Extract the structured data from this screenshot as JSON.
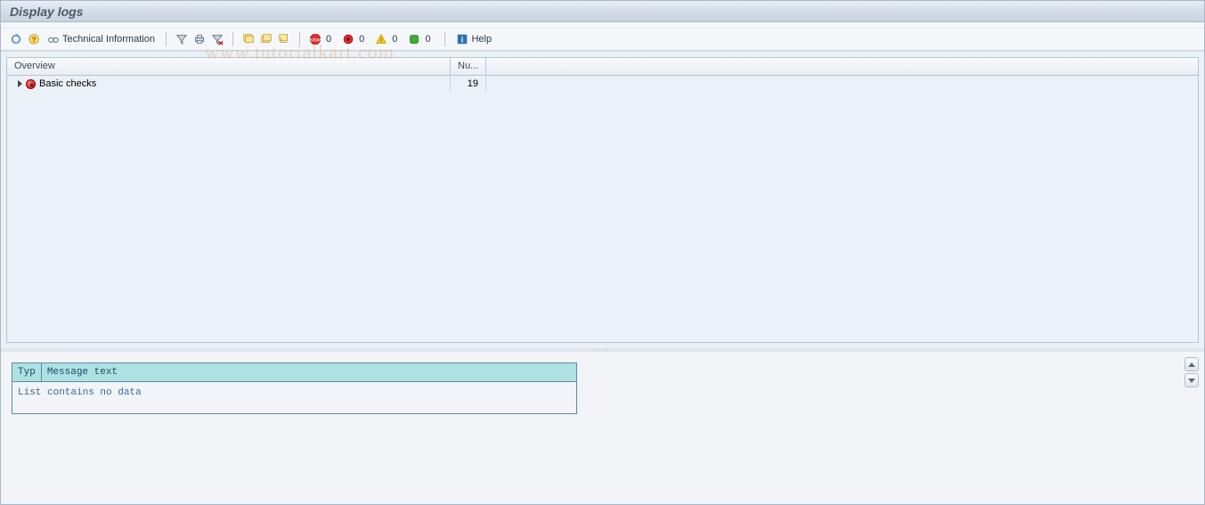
{
  "title": "Display logs",
  "toolbar": {
    "tech_info_label": "Technical Information",
    "cancel_count": "0",
    "error_count": "0",
    "warning_count": "0",
    "success_count": "0",
    "help_label": "Help"
  },
  "grid": {
    "headers": {
      "overview": "Overview",
      "num": "Nu..."
    },
    "rows": [
      {
        "label": "Basic checks",
        "count": "19",
        "status": "error"
      }
    ]
  },
  "messages": {
    "col_typ": "Typ",
    "col_text": "Message text",
    "empty": "List contains no data"
  },
  "watermark": "www.tutorialkart.com"
}
